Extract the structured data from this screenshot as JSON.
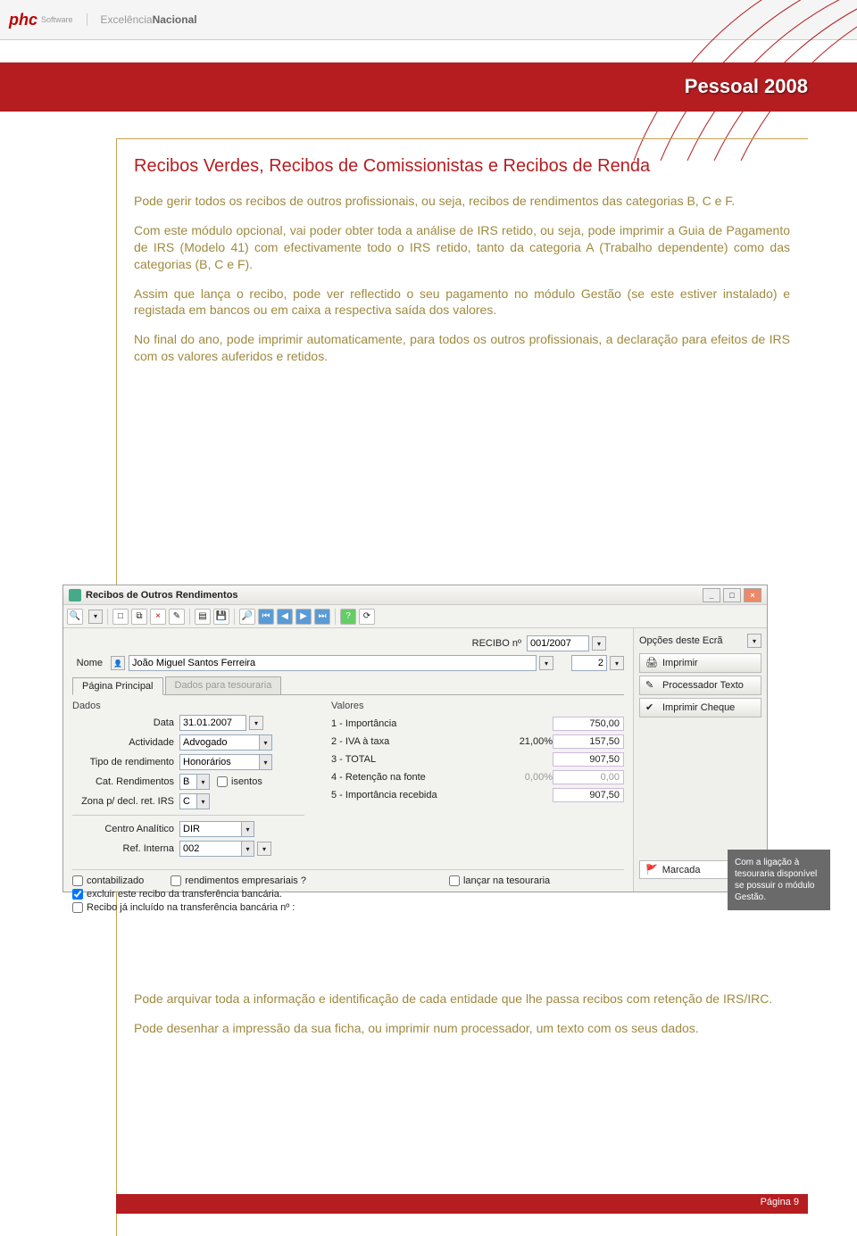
{
  "header": {
    "logo_main": "phc",
    "logo_sub": "Software",
    "tagline_light": "Excelência",
    "tagline_bold": "Nacional"
  },
  "banner": {
    "title": "Pessoal 2008"
  },
  "doc": {
    "heading": "Recibos Verdes, Recibos de Comissionistas e Recibos de Renda",
    "p1": "Pode gerir todos os recibos de outros profissionais, ou seja, recibos de rendimentos das categorias B, C e F.",
    "p2": "Com este módulo opcional, vai poder obter toda a análise de IRS retido, ou seja, pode imprimir a Guia de Pagamento de IRS (Modelo 41) com efectivamente todo o IRS retido, tanto da categoria A (Trabalho dependente) como das categorias (B, C e F).",
    "p3": "Assim que lança o recibo, pode ver reflectido o seu pagamento no módulo Gestão (se este estiver instalado) e registada em bancos ou em caixa a respectiva saída dos valores.",
    "p4": "No final do ano, pode imprimir automaticamente, para todos os outros profissionais, a declaração para efeitos de IRS com os valores auferidos e retidos.",
    "p5": "Pode arquivar toda a informação e identificação de cada entidade que lhe passa recibos com retenção de IRS/IRC.",
    "p6": "Pode desenhar a impressão da sua ficha, ou imprimir num processador, um texto com os seus  dados."
  },
  "window": {
    "title": "Recibos de Outros Rendimentos",
    "recibo_lbl": "RECIBO nº",
    "recibo_val": "001/2007",
    "nome_lbl": "Nome",
    "nome_val": "João Miguel Santos Ferreira",
    "num2": "2",
    "tabs": [
      "Página Principal",
      "Dados para tesouraria"
    ],
    "dados_hdr": "Dados",
    "valores_hdr": "Valores",
    "fields": {
      "data_lbl": "Data",
      "data_val": "31.01.2007",
      "activ_lbl": "Actividade",
      "activ_val": "Advogado",
      "tipo_lbl": "Tipo de rendimento",
      "tipo_val": "Honorários",
      "cat_lbl": "Cat. Rendimentos",
      "cat_val": "B",
      "isentos_lbl": "isentos",
      "zona_lbl": "Zona p/ decl. ret. IRS",
      "zona_val": "C",
      "centro_lbl": "Centro Analítico",
      "centro_val": "DIR",
      "ref_lbl": "Ref. Interna",
      "ref_val": "002"
    },
    "values": [
      {
        "label": "1 - Importância",
        "mid": "",
        "num": "750,00"
      },
      {
        "label": "2 - IVA à taxa",
        "mid": "21,00%",
        "num": "157,50"
      },
      {
        "label": "3 - TOTAL",
        "mid": "",
        "num": "907,50"
      },
      {
        "label": "4 - Retenção na fonte",
        "mid": "0,00%",
        "num": "0,00",
        "grey": true
      },
      {
        "label": "5 - Importância recebida",
        "mid": "",
        "num": "907,50"
      }
    ],
    "checks": {
      "contab": "contabilizado",
      "rend_emp": "rendimentos empresariais ?",
      "lancar": "lançar na tesouraria",
      "excluir": "excluir este recibo da transferência bancária.",
      "incluido": "Recibo já incluído na transferência bancária nº :"
    },
    "side": {
      "header": "Opções deste Ecrã",
      "b1": "Imprimir",
      "b2": "Processador Texto",
      "b3": "Imprimir Cheque",
      "marcada": "Marcada"
    }
  },
  "callout": "Com a  ligação à tesouraria disponível se possuir o módulo Gestão.",
  "footer": {
    "page": "Página 9"
  }
}
